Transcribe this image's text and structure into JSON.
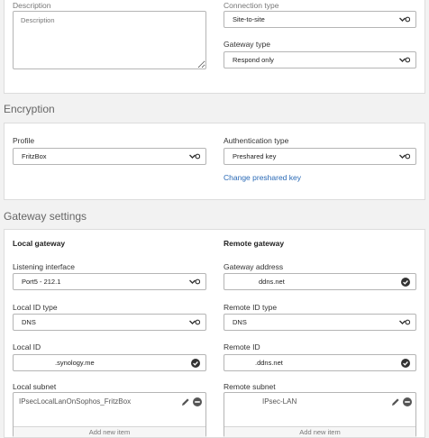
{
  "general": {
    "description_label": "Description",
    "description_placeholder": "Description",
    "connection_type_label": "Connection type",
    "connection_type_value": "Site-to-site",
    "gateway_type_label": "Gateway type",
    "gateway_type_value": "Respond only"
  },
  "encryption": {
    "title": "Encryption",
    "profile_label": "Profile",
    "profile_value": "FritzBox",
    "auth_type_label": "Authentication type",
    "auth_type_value": "Preshared key",
    "change_key_link": "Change preshared key"
  },
  "gateway": {
    "title": "Gateway settings",
    "local": {
      "heading": "Local gateway",
      "listening_label": "Listening interface",
      "listening_value": "Port5 - 212.1",
      "id_type_label": "Local ID type",
      "id_type_value": "DNS",
      "id_label": "Local ID",
      "id_value": ".synology.me",
      "subnet_label": "Local subnet",
      "subnet_item": "IPsecLocalLanOnSophos_FritzBox",
      "add_item": "Add new item"
    },
    "remote": {
      "heading": "Remote gateway",
      "address_label": "Gateway address",
      "address_value": "ddns.net",
      "id_type_label": "Remote ID type",
      "id_type_value": "DNS",
      "id_label": "Remote ID",
      "id_value": ".ddns.net",
      "subnet_label": "Remote subnet",
      "subnet_item": "IPsec-LAN",
      "add_item": "Add new item"
    }
  },
  "icons": {
    "dropdown": "chevron-down-icon",
    "valid": "check-circle-icon",
    "edit": "pencil-icon",
    "remove": "minus-circle-icon"
  },
  "colors": {
    "link": "#2a6ab6",
    "check": "#333333"
  }
}
